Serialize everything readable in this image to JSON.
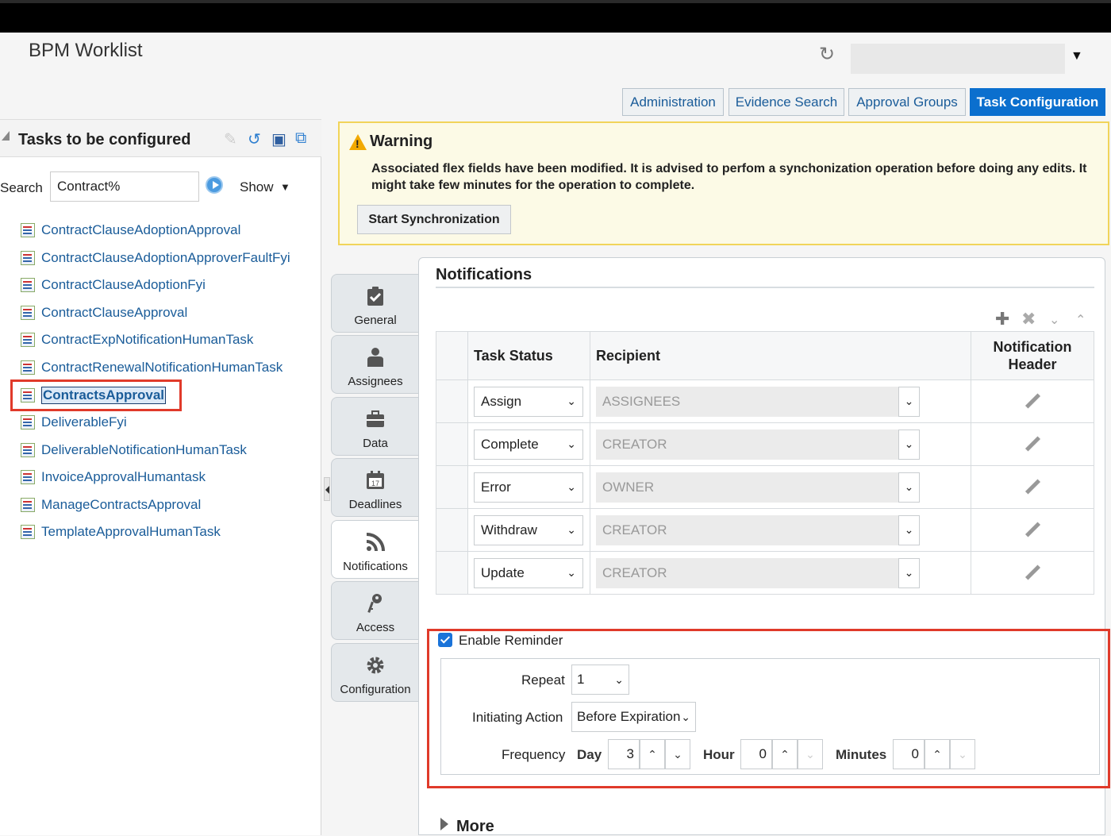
{
  "app": {
    "title": "BPM Worklist"
  },
  "header": {
    "tabs": [
      {
        "label": "Administration"
      },
      {
        "label": "Evidence Search"
      },
      {
        "label": "Approval Groups"
      },
      {
        "label": "Task Configuration",
        "active": true
      }
    ]
  },
  "sidebar": {
    "title": "Tasks to be configured",
    "search_label": "Search",
    "search_value": "Contract%",
    "show_label": "Show",
    "tasks": [
      {
        "label": "ContractClauseAdoptionApproval"
      },
      {
        "label": "ContractClauseAdoptionApproverFaultFyi"
      },
      {
        "label": "ContractClauseAdoptionFyi"
      },
      {
        "label": "ContractClauseApproval"
      },
      {
        "label": "ContractExpNotificationHumanTask"
      },
      {
        "label": "ContractRenewalNotificationHumanTask"
      },
      {
        "label": "ContractsApproval",
        "selected": true
      },
      {
        "label": "DeliverableFyi"
      },
      {
        "label": "DeliverableNotificationHumanTask"
      },
      {
        "label": "InvoiceApprovalHumantask"
      },
      {
        "label": "ManageContractsApproval"
      },
      {
        "label": "TemplateApprovalHumanTask"
      }
    ]
  },
  "warning": {
    "title": "Warning",
    "message": "Associated flex fields have been modified. It is advised to perfom a synchonization operation before doing any edits. It might take few minutes for the operation to complete.",
    "button": "Start Synchronization"
  },
  "vtabs": [
    {
      "label": "General",
      "icon": "clipboard-check-icon"
    },
    {
      "label": "Assignees",
      "icon": "person-icon"
    },
    {
      "label": "Data",
      "icon": "briefcase-icon"
    },
    {
      "label": "Deadlines",
      "icon": "calendar-icon",
      "icon_text": "17"
    },
    {
      "label": "Notifications",
      "icon": "rss-icon",
      "active": true
    },
    {
      "label": "Access",
      "icon": "keys-icon"
    },
    {
      "label": "Configuration",
      "icon": "gear-icon"
    }
  ],
  "notifications": {
    "title": "Notifications",
    "columns": {
      "status": "Task Status",
      "recipient": "Recipient",
      "header": "Notification Header"
    },
    "rows": [
      {
        "status": "Assign",
        "recipient": "ASSIGNEES"
      },
      {
        "status": "Complete",
        "recipient": "CREATOR"
      },
      {
        "status": "Error",
        "recipient": "OWNER"
      },
      {
        "status": "Withdraw",
        "recipient": "CREATOR"
      },
      {
        "status": "Update",
        "recipient": "CREATOR"
      }
    ]
  },
  "reminder": {
    "enable_label": "Enable Reminder",
    "enabled": true,
    "repeat_label": "Repeat",
    "repeat_value": "1",
    "initiating_label": "Initiating Action",
    "initiating_value": "Before Expiration",
    "frequency_label": "Frequency",
    "day_label": "Day",
    "day_value": "3",
    "hour_label": "Hour",
    "hour_value": "0",
    "minutes_label": "Minutes",
    "minutes_value": "0"
  },
  "more_label": "More",
  "colors": {
    "accent": "#0b6fce",
    "link": "#1a5c99",
    "highlight": "#e03a2a",
    "warning_bg": "#fcfae6"
  }
}
